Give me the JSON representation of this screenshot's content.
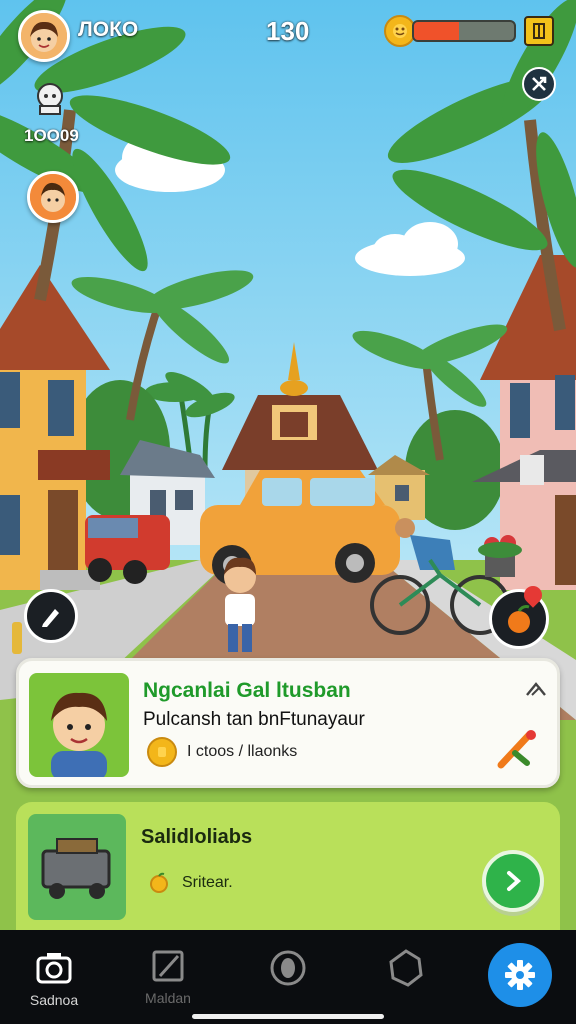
{
  "hud": {
    "player_name": "ЛОКО",
    "center_counter": "130",
    "energy_level": 0.45,
    "score_label": "1ОО09",
    "colors": {
      "energy_fill": "#f0522a",
      "coin": "#f3b61a"
    }
  },
  "quest_card": {
    "title": "Ngcanlai Gal ltusban",
    "subtitle": "Pulcansh tan bnFtunayaur",
    "meta": "Ӏ ctoos / llaonks",
    "title_color": "#1f9a2a"
  },
  "shop_card": {
    "title": "Salidloliabs",
    "price_label": "Sritear."
  },
  "nav": {
    "items": [
      {
        "label": "Sadnoa",
        "icon": "camera-icon"
      },
      {
        "label": "Maldan",
        "icon": "edit-icon"
      },
      {
        "label": "",
        "icon": "record-icon"
      },
      {
        "label": "",
        "icon": "badge-icon"
      },
      {
        "label": "",
        "icon": "settings-icon"
      }
    ],
    "active_color": "#1e8fe8"
  }
}
